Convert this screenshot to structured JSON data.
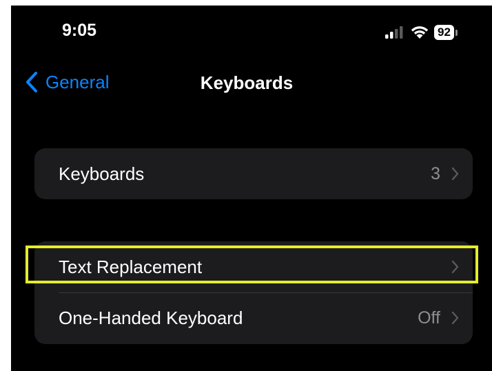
{
  "status_bar": {
    "time": "9:05",
    "battery_percent": "92",
    "icons": [
      "cellular-signal-icon",
      "wifi-icon",
      "battery-icon"
    ]
  },
  "nav": {
    "back_label": "General",
    "title": "Keyboards",
    "back_icon": "chevron-left-icon"
  },
  "groups": [
    {
      "rows": [
        {
          "label": "Keyboards",
          "value": "3"
        }
      ]
    },
    {
      "rows": [
        {
          "label": "Text Replacement",
          "value": "",
          "highlighted": true
        },
        {
          "label": "One-Handed Keyboard",
          "value": "Off"
        }
      ]
    }
  ],
  "colors": {
    "background": "#000000",
    "group_background": "#1c1c1e",
    "accent": "#0a84ff",
    "secondary_text": "#8e8e93",
    "highlight_border": "#e5ec2a"
  }
}
